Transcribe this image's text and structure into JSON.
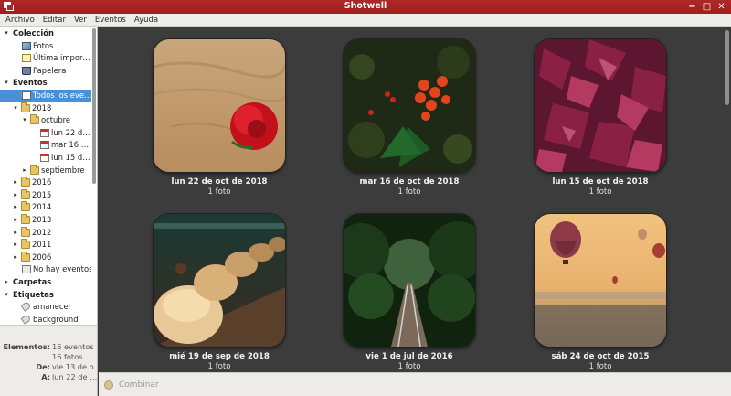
{
  "window": {
    "title": "Shotwell"
  },
  "menubar": [
    "Archivo",
    "Editar",
    "Ver",
    "Eventos",
    "Ayuda"
  ],
  "sidebar": {
    "rows": [
      {
        "label": "Colección",
        "level": 0,
        "arrow": "▾",
        "icon": "",
        "header": true
      },
      {
        "label": "Fotos",
        "level": 1,
        "arrow": "",
        "icon": "photos"
      },
      {
        "label": "Última impor…",
        "level": 1,
        "arrow": "",
        "icon": "last-import"
      },
      {
        "label": "Papelera",
        "level": 1,
        "arrow": "",
        "icon": "trash"
      },
      {
        "label": "Eventos",
        "level": 0,
        "arrow": "▾",
        "icon": "",
        "header": true
      },
      {
        "label": "Todos los eve…",
        "level": 1,
        "arrow": "",
        "icon": "events",
        "selected": true
      },
      {
        "label": "2018",
        "level": 1,
        "arrow": "▾",
        "icon": "folder"
      },
      {
        "label": "octubre",
        "level": 2,
        "arrow": "▾",
        "icon": "folder"
      },
      {
        "label": "lun 22 d…",
        "level": 3,
        "arrow": "",
        "icon": "calendar"
      },
      {
        "label": "mar 16 …",
        "level": 3,
        "arrow": "",
        "icon": "calendar"
      },
      {
        "label": "lun 15 d…",
        "level": 3,
        "arrow": "",
        "icon": "calendar"
      },
      {
        "label": "septiembre",
        "level": 2,
        "arrow": "▸",
        "icon": "folder"
      },
      {
        "label": "2016",
        "level": 1,
        "arrow": "▸",
        "icon": "folder"
      },
      {
        "label": "2015",
        "level": 1,
        "arrow": "▸",
        "icon": "folder"
      },
      {
        "label": "2014",
        "level": 1,
        "arrow": "▸",
        "icon": "folder"
      },
      {
        "label": "2013",
        "level": 1,
        "arrow": "▸",
        "icon": "folder"
      },
      {
        "label": "2012",
        "level": 1,
        "arrow": "▸",
        "icon": "folder"
      },
      {
        "label": "2011",
        "level": 1,
        "arrow": "▸",
        "icon": "folder"
      },
      {
        "label": "2006",
        "level": 1,
        "arrow": "▸",
        "icon": "folder"
      },
      {
        "label": "No hay eventos",
        "level": 1,
        "arrow": "",
        "icon": "no-event"
      },
      {
        "label": "Carpetas",
        "level": 0,
        "arrow": "▸",
        "icon": "",
        "header": true
      },
      {
        "label": "Etiquetas",
        "level": 0,
        "arrow": "▾",
        "icon": "",
        "header": true
      },
      {
        "label": "amanecer",
        "level": 1,
        "arrow": "",
        "icon": "tag"
      },
      {
        "label": "background",
        "level": 1,
        "arrow": "",
        "icon": "tag"
      }
    ]
  },
  "info": {
    "rows": [
      {
        "key": "Elementos:",
        "value": "16 eventos"
      },
      {
        "key": "",
        "value": "16 fotos"
      },
      {
        "key": "De:",
        "value": "vie 13 de o…"
      },
      {
        "key": "A:",
        "value": "lun 22 de …"
      }
    ]
  },
  "events": [
    {
      "title": "lun 22 de oct de 2018",
      "count": "1 foto",
      "photo": "rose-sand"
    },
    {
      "title": "mar 16 de oct de 2018",
      "count": "1 foto",
      "photo": "holly-berries"
    },
    {
      "title": "lun 15 de oct de 2018",
      "count": "1 foto",
      "photo": "autumn-leaves"
    },
    {
      "title": "mié 19 de sep de 2018",
      "count": "1 foto",
      "photo": "dried-fruit"
    },
    {
      "title": "vie 1 de jul de 2016",
      "count": "1 foto",
      "photo": "forest-railway"
    },
    {
      "title": "sáb 24 de oct de 2015",
      "count": "1 foto",
      "photo": "hot-air-balloons"
    }
  ],
  "toolbar": {
    "merge_label": "Combinar"
  },
  "colors": {
    "titlebar": "#a82222",
    "selection": "#4a90d9",
    "content_bg": "#3c3c3c",
    "panel_bg": "#eeece8"
  }
}
